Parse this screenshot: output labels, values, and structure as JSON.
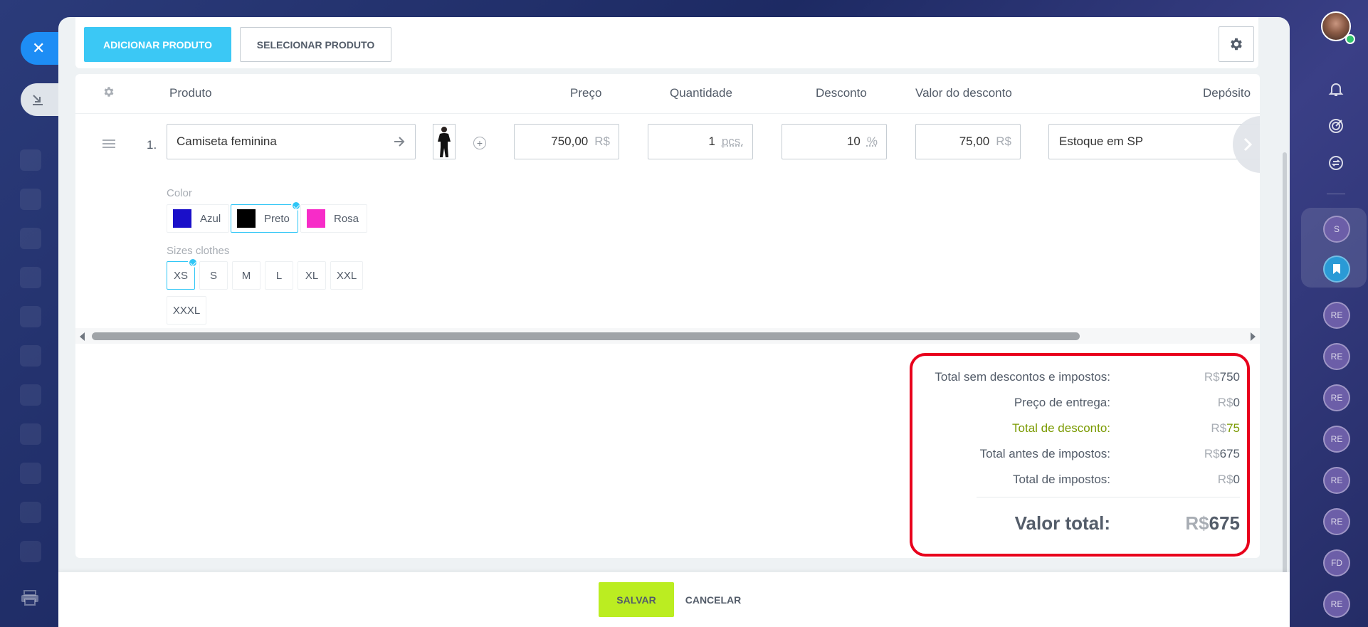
{
  "toolbar": {
    "add_product_label": "ADICIONAR PRODUTO",
    "select_product_label": "SELECIONAR PRODUTO"
  },
  "table": {
    "headers": {
      "product": "Produto",
      "price": "Preço",
      "quantity": "Quantidade",
      "discount": "Desconto",
      "discount_value": "Valor do desconto",
      "warehouse": "Depósito"
    },
    "row": {
      "number": "1.",
      "product_name": "Camiseta feminina",
      "price": "750,00",
      "price_currency": "R$",
      "quantity": "1",
      "quantity_unit": "pcs.",
      "discount": "10",
      "discount_unit": "%",
      "discount_value": "75,00",
      "discount_value_currency": "R$",
      "warehouse": "Estoque em SP"
    },
    "color_property": {
      "label": "Color",
      "options": [
        {
          "name": "Azul",
          "hex": "#1a0fc9",
          "selected": false
        },
        {
          "name": "Preto",
          "hex": "#000000",
          "selected": true
        },
        {
          "name": "Rosa",
          "hex": "#f72cc8",
          "selected": false
        }
      ]
    },
    "size_property": {
      "label": "Sizes clothes",
      "options": [
        {
          "name": "XS",
          "selected": true
        },
        {
          "name": "S",
          "selected": false
        },
        {
          "name": "M",
          "selected": false
        },
        {
          "name": "L",
          "selected": false
        },
        {
          "name": "XL",
          "selected": false
        },
        {
          "name": "XXL",
          "selected": false
        },
        {
          "name": "XXXL",
          "selected": false
        }
      ]
    }
  },
  "totals": {
    "currency": "R$",
    "rows": [
      {
        "label": "Total sem descontos e impostos:",
        "value": "750"
      },
      {
        "label": "Preço de entrega:",
        "value": "0"
      },
      {
        "label": "Total de desconto:",
        "value": "75"
      },
      {
        "label": "Total antes de impostos:",
        "value": "675"
      },
      {
        "label": "Total de impostos:",
        "value": "0"
      }
    ],
    "grand_label": "Valor total:",
    "grand_value": "675"
  },
  "footer": {
    "save_label": "SALVAR",
    "cancel_label": "CANCELAR"
  },
  "right_rail": {
    "group_chip": "S",
    "chips": [
      "RE",
      "RE",
      "RE",
      "RE",
      "RE",
      "RE",
      "FD",
      "RE"
    ]
  },
  "colors": {
    "accent_blue": "#3bc8f5",
    "save_green": "#bbed21",
    "discount_green": "#7a9a01",
    "highlight_red": "#e8001c",
    "close_blue": "#1d8df5"
  }
}
